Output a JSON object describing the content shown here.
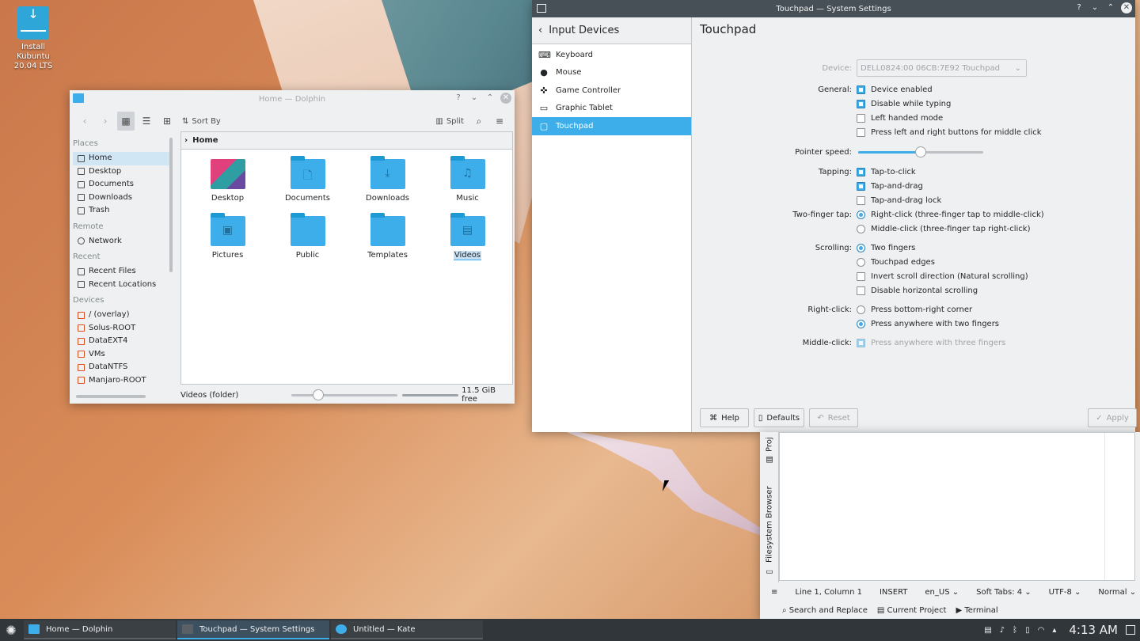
{
  "desktop": {
    "icon_label": "Install Kubuntu 20.04 LTS"
  },
  "dolphin": {
    "title": "Home — Dolphin",
    "toolbar": {
      "sort_label": "Sort By",
      "split_label": "Split"
    },
    "places": {
      "places_header": "Places",
      "places_items": [
        "Home",
        "Desktop",
        "Documents",
        "Downloads",
        "Trash"
      ],
      "remote_header": "Remote",
      "remote_items": [
        "Network"
      ],
      "recent_header": "Recent",
      "recent_items": [
        "Recent Files",
        "Recent Locations"
      ],
      "devices_header": "Devices",
      "devices_items": [
        "/ (overlay)",
        "Solus-ROOT",
        "DataEXT4",
        "VMs",
        "DataNTFS",
        "Manjaro-ROOT"
      ]
    },
    "breadcrumb": "Home",
    "files": [
      {
        "label": "Desktop",
        "glyph": ""
      },
      {
        "label": "Documents",
        "glyph": "🗋"
      },
      {
        "label": "Downloads",
        "glyph": "⤓"
      },
      {
        "label": "Music",
        "glyph": "♫"
      },
      {
        "label": "Pictures",
        "glyph": "▣"
      },
      {
        "label": "Public",
        "glyph": ""
      },
      {
        "label": "Templates",
        "glyph": ""
      },
      {
        "label": "Videos",
        "glyph": "▤"
      }
    ],
    "status_text": "Videos (folder)",
    "free_space": "11.5 GiB free",
    "zoom_level": 0.25
  },
  "settings": {
    "title": "Touchpad — System Settings",
    "nav_header": "Input Devices",
    "nav_items": [
      "Keyboard",
      "Mouse",
      "Game Controller",
      "Graphic Tablet",
      "Touchpad"
    ],
    "page_title": "Touchpad",
    "device_label": "Device:",
    "device_value": "DELL0824:00 06CB:7E92 Touchpad",
    "general_label": "General:",
    "general": [
      "Device enabled",
      "Disable while typing",
      "Left handed mode",
      "Press left and right buttons for middle click"
    ],
    "pointer_speed_label": "Pointer speed:",
    "pointer_speed": 0.5,
    "tapping_label": "Tapping:",
    "tapping": [
      "Tap-to-click",
      "Tap-and-drag",
      "Tap-and-drag lock"
    ],
    "two_finger_label": "Two-finger tap:",
    "two_finger": [
      "Right-click (three-finger tap to middle-click)",
      "Middle-click (three-finger tap right-click)"
    ],
    "scrolling_label": "Scrolling:",
    "scrolling": [
      "Two fingers",
      "Touchpad edges",
      "Invert scroll direction (Natural scrolling)",
      "Disable horizontal scrolling"
    ],
    "rightclick_label": "Right-click:",
    "rightclick": [
      "Press bottom-right corner",
      "Press anywhere with two fingers"
    ],
    "middleclick_label": "Middle-click:",
    "middleclick": "Press anywhere with three fingers",
    "buttons": {
      "help": "Help",
      "defaults": "Defaults",
      "reset": "Reset",
      "apply": "Apply"
    }
  },
  "kate": {
    "side_tab_1": "Filesystem Browser",
    "side_tab_2": "Proj",
    "status": {
      "position": "Line 1, Column 1",
      "mode": "INSERT",
      "lang": "en_US",
      "tabs": "Soft Tabs: 4",
      "encoding": "UTF-8",
      "highlight": "Normal"
    },
    "tools": {
      "search": "Search and Replace",
      "project": "Current Project",
      "terminal": "Terminal"
    }
  },
  "taskbar": {
    "tasks": [
      "Home — Dolphin",
      "Touchpad — System Settings",
      "Untitled — Kate"
    ],
    "clock": "4:13 AM"
  }
}
